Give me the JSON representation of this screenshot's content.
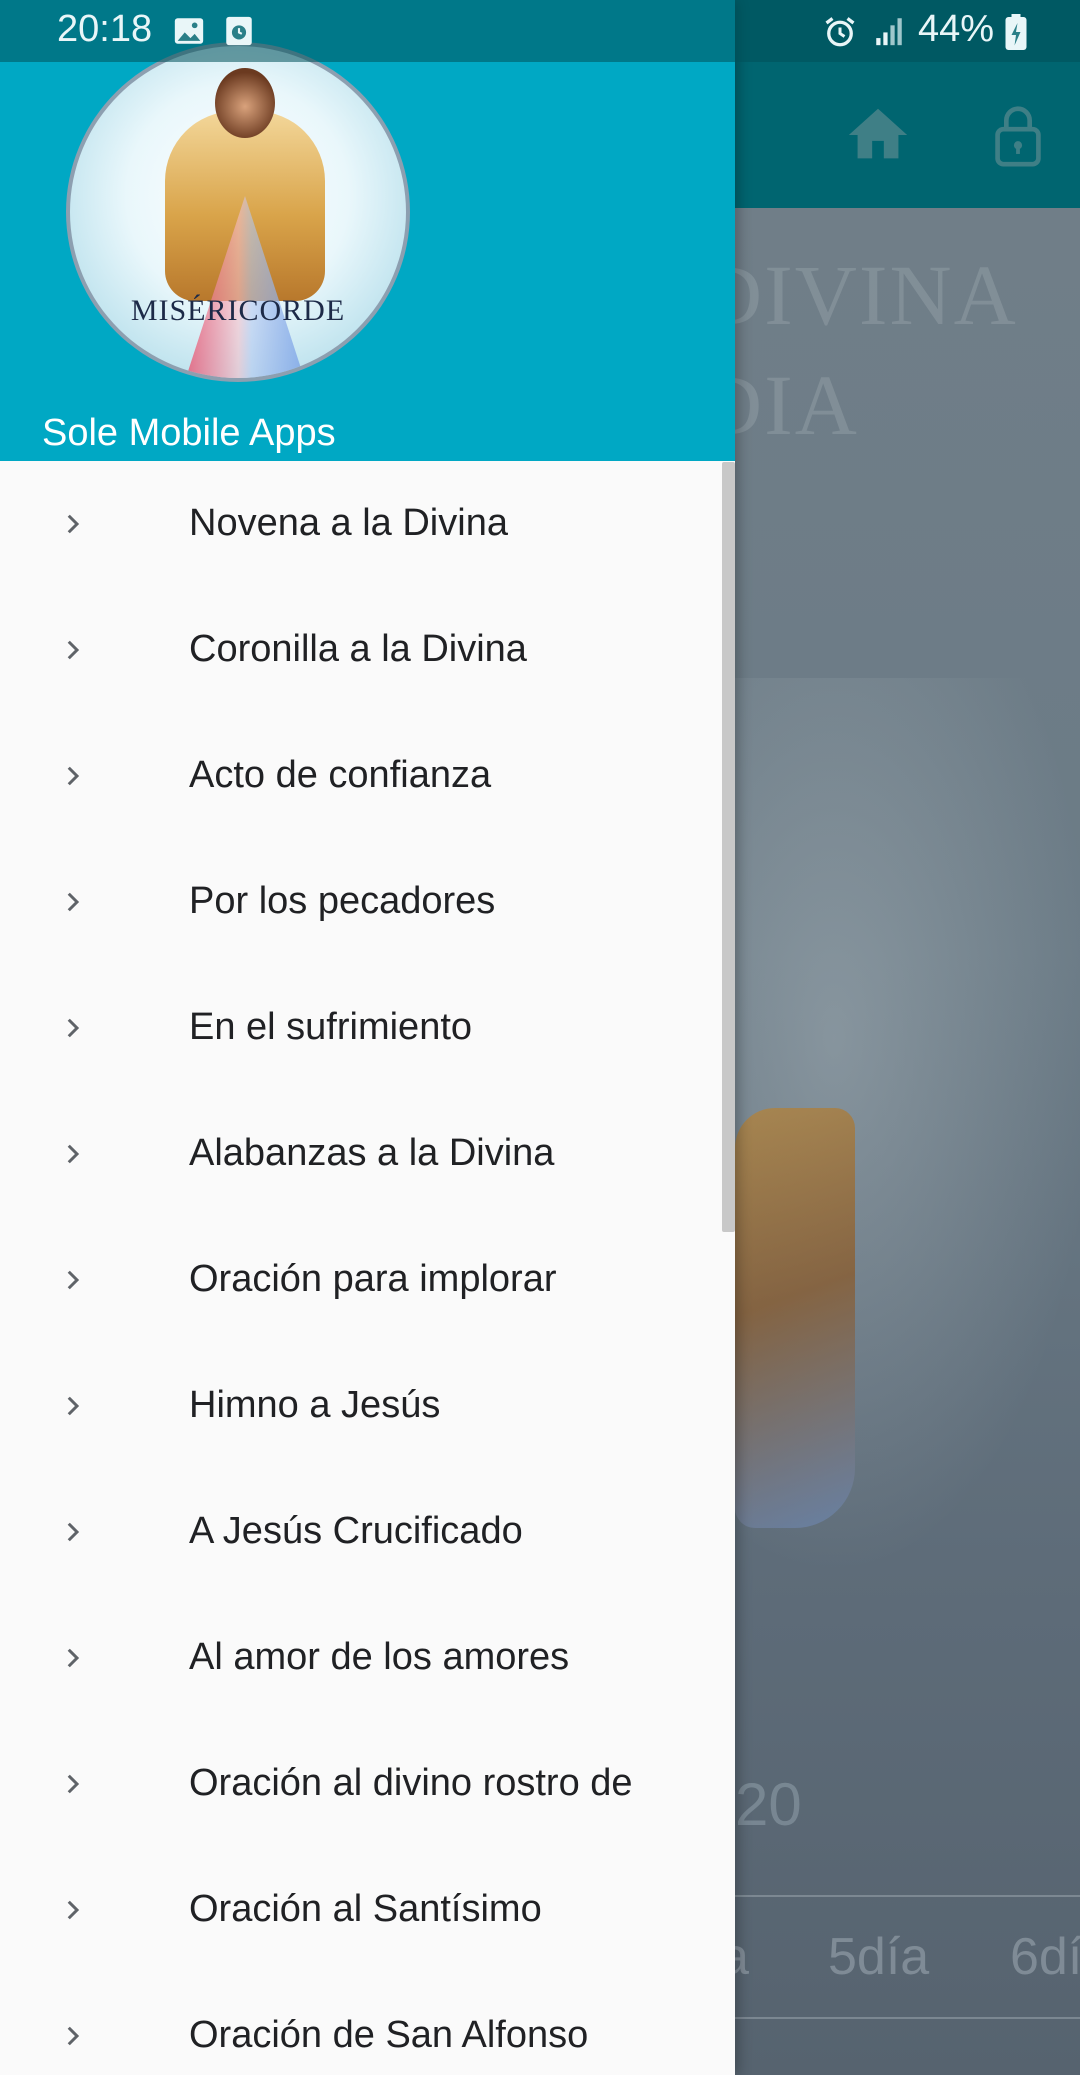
{
  "status_bar": {
    "time": "20:18",
    "battery": "44%",
    "icons": [
      "image-icon",
      "media-icon",
      "alarm-icon",
      "signal-icon",
      "battery-icon"
    ]
  },
  "background_app": {
    "title_lines": [
      "DIVINA",
      "DIA"
    ],
    "year_text": "20",
    "tabs": [
      "a",
      "5día",
      "6dí"
    ],
    "toolbar_icons": [
      "home-icon",
      "lock-icon"
    ]
  },
  "drawer": {
    "logo_text": "MISÉRICORDE",
    "subtitle": "Sole Mobile Apps",
    "items": [
      {
        "label": "Novena a la Divina"
      },
      {
        "label": "Coronilla a la Divina"
      },
      {
        "label": "Acto de confianza"
      },
      {
        "label": "Por los pecadores"
      },
      {
        "label": "En el sufrimiento"
      },
      {
        "label": "Alabanzas a la Divina"
      },
      {
        "label": "Oración para implorar"
      },
      {
        "label": "Himno a Jesús"
      },
      {
        "label": "A Jesús Crucificado"
      },
      {
        "label": "Al amor de los amores"
      },
      {
        "label": "Oración al divino rostro de"
      },
      {
        "label": "Oración al Santísimo"
      },
      {
        "label": "Oración de San Alfonso"
      }
    ]
  },
  "colors": {
    "drawer_header": "#00a8c4",
    "toolbar": "#006570",
    "drawer_bg": "#fafafa",
    "menu_text": "#202124"
  }
}
